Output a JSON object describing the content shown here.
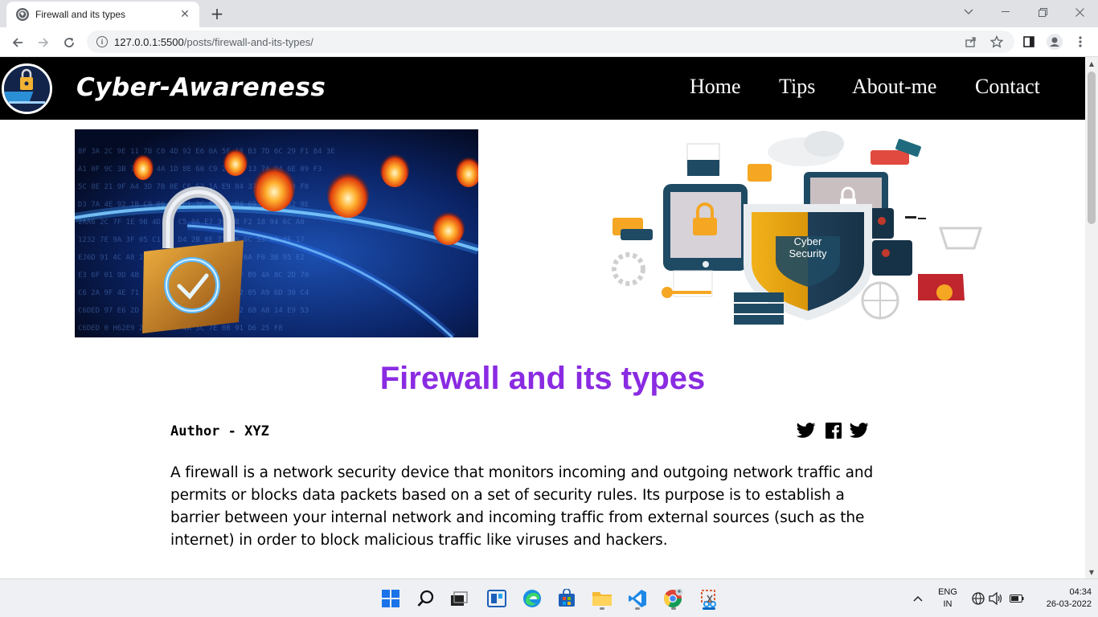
{
  "browser": {
    "tab_title": "Firewall and its types",
    "url_host": "127.0.0.1:5500",
    "url_path": "/posts/firewall-and-its-types/"
  },
  "site": {
    "brand": "Cyber-Awareness",
    "nav": [
      "Home",
      "Tips",
      "About-me",
      "Contact"
    ],
    "hero_badge": "Cyber\nSecurity"
  },
  "post": {
    "title": "Firewall and its types",
    "author": "Author - XYZ",
    "share_icons": [
      "twitter-icon",
      "facebook-icon",
      "twitter-icon"
    ],
    "body": "A firewall is a network security device that monitors incoming and outgoing network traffic and permits or blocks data packets based on a set of security rules. Its purpose is to establish a barrier between your internal network and incoming traffic from external sources (such as the internet) in order to block malicious traffic like viruses and hackers."
  },
  "taskbar": {
    "apps": [
      "windows-start-icon",
      "search-icon",
      "task-view-icon",
      "widgets-icon",
      "edge-icon",
      "store-icon",
      "file-explorer-icon",
      "vscode-icon",
      "chrome-icon",
      "snipping-tool-icon"
    ],
    "lang_top": "ENG",
    "lang_bottom": "IN",
    "time": "04:34",
    "date": "26-03-2022"
  },
  "colors": {
    "title_purple": "#8a2be2",
    "nav_bg": "#000000",
    "accent_blue": "#0067c0"
  }
}
